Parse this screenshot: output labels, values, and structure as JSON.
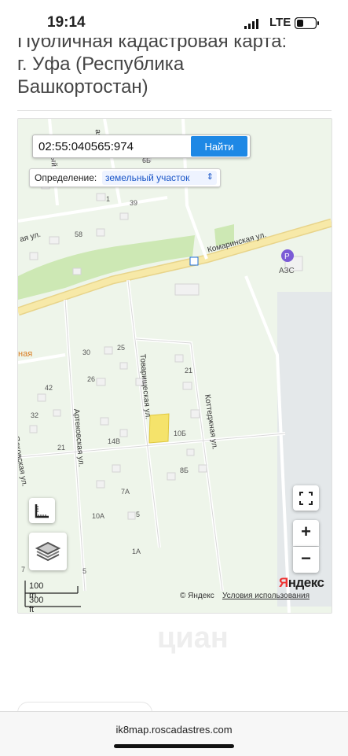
{
  "status": {
    "time": "19:14",
    "network": "LTE"
  },
  "page": {
    "title_line1": "Публичная кадастровая карта:",
    "title_line2": "г. Уфа (Республика",
    "title_line3": "Башкортостан)"
  },
  "search": {
    "value": "02:55:040565:974",
    "button": "Найти"
  },
  "definition": {
    "label": "Определение:",
    "selected": "земельный участок"
  },
  "map": {
    "streets": {
      "komarinskaya": "Комаринская ул.",
      "tovarishcheskaya": "Товарищеская ул.",
      "kottedzhnaya": "Коттеджная ул.",
      "artekovskaya": "Артековская ул.",
      "left_vertical": "Ялковская ул.",
      "top_left": "ый пер.",
      "top_left2": "ая ул.",
      "top_fragment": "ая ул",
      "orange": "ная"
    },
    "poi": {
      "azs": "АЗС"
    },
    "house_numbers": [
      "6Б",
      "1",
      "39",
      "58",
      "30",
      "25",
      "21",
      "26",
      "42",
      "32",
      "21",
      "14В",
      "10Б",
      "8Б",
      "7А",
      "10А",
      "5",
      "1А",
      "5",
      "7"
    ],
    "scale_metric": "100 m",
    "scale_imperial": "300 ft",
    "copyright": "© Яндекс",
    "terms": "Условия использования",
    "logo_first": "Я",
    "logo_rest": "ндекс"
  },
  "browser": {
    "url": "ik8map.roscadastres.com"
  },
  "watermark": "циан",
  "colors": {
    "accent": "#1e88e5",
    "road": "#f7e9a8",
    "park": "#cde8b4",
    "parcel": "#f5e36b"
  }
}
